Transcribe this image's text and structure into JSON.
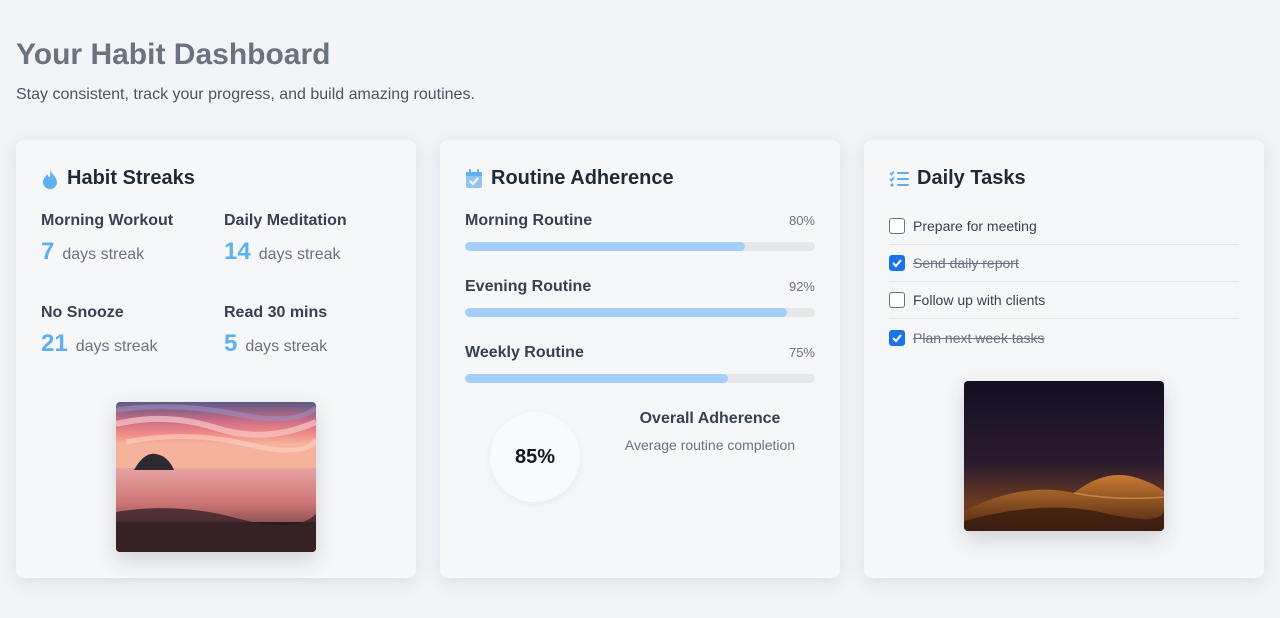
{
  "header": {
    "title": "Your Habit Dashboard",
    "subtitle": "Stay consistent, track your progress, and build amazing routines."
  },
  "colors": {
    "accent": "#5fb0ee",
    "bar_fill": "#a5cff8",
    "checkbox_checked": "#1a73e8"
  },
  "streaks": {
    "title": "Habit Streaks",
    "icon": "flame-icon",
    "items": [
      {
        "name": "Morning Workout",
        "count": "7",
        "unit": "days streak"
      },
      {
        "name": "Daily Meditation",
        "count": "14",
        "unit": "days streak"
      },
      {
        "name": "No Snooze",
        "count": "21",
        "unit": "days streak"
      },
      {
        "name": "Read 30 mins",
        "count": "5",
        "unit": "days streak"
      }
    ],
    "image": "sunset-beach-photo"
  },
  "routines": {
    "title": "Routine Adherence",
    "icon": "calendar-check-icon",
    "items": [
      {
        "name": "Morning Routine",
        "percent_label": "80%",
        "percent": 80
      },
      {
        "name": "Evening Routine",
        "percent_label": "92%",
        "percent": 92
      },
      {
        "name": "Weekly Routine",
        "percent_label": "75%",
        "percent": 75
      }
    ],
    "overall": {
      "value": "85%",
      "title": "Overall Adherence",
      "subtitle": "Average routine completion"
    }
  },
  "tasks": {
    "title": "Daily Tasks",
    "icon": "checklist-icon",
    "items": [
      {
        "label": "Prepare for meeting",
        "done": false
      },
      {
        "label": "Send daily report",
        "done": true
      },
      {
        "label": "Follow up with clients",
        "done": false
      },
      {
        "label": "Plan next week tasks",
        "done": true
      }
    ],
    "image": "desert-dunes-night-photo"
  }
}
